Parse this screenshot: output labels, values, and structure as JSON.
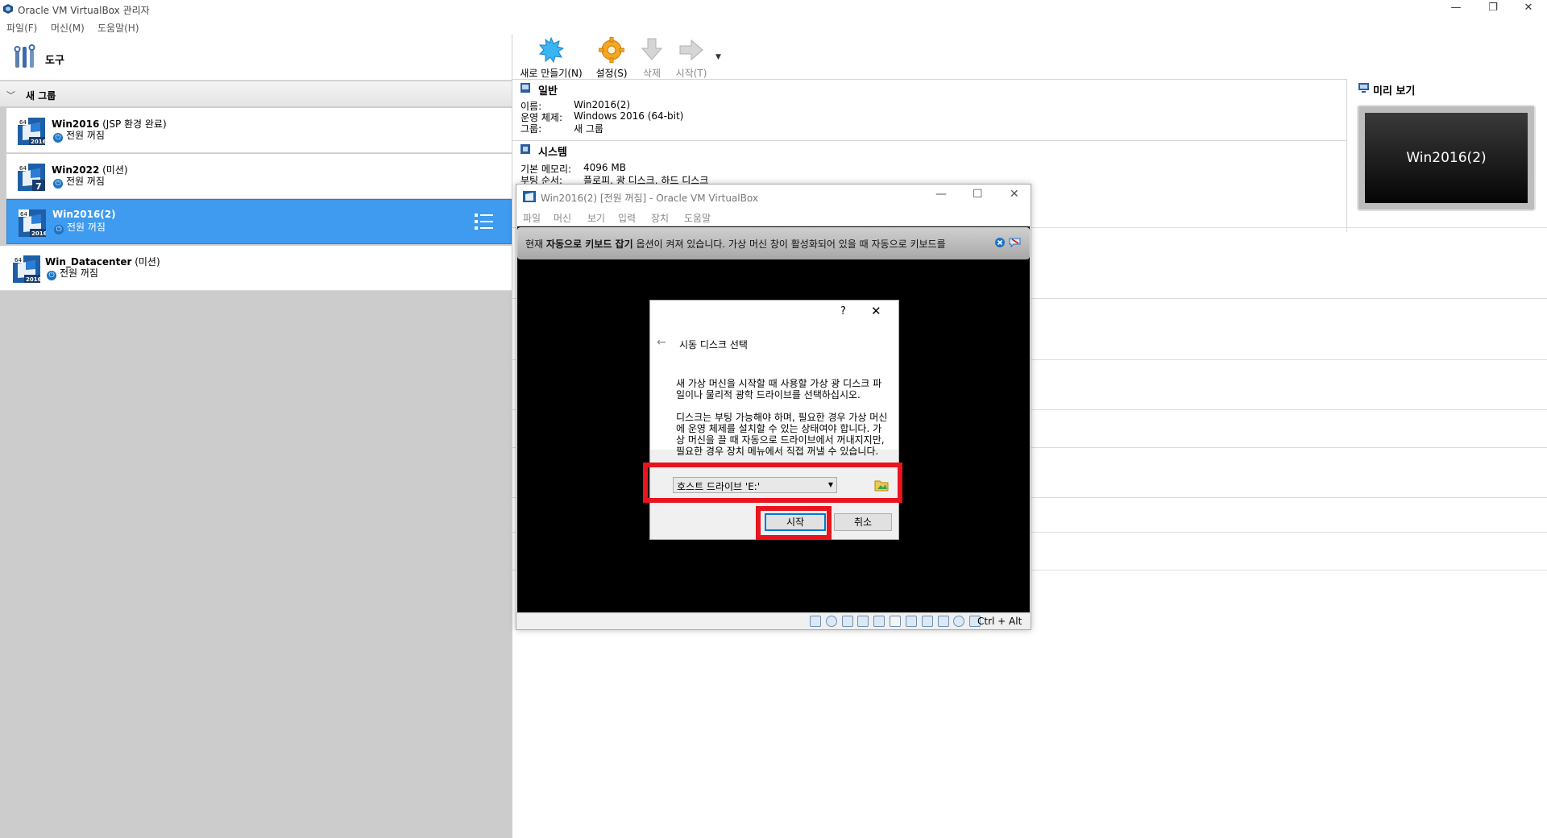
{
  "window": {
    "title": "Oracle VM VirtualBox 관리자"
  },
  "menu": [
    "파일(F)",
    "머신(M)",
    "도움말(H)"
  ],
  "tools": {
    "label": "도구"
  },
  "group": {
    "label": "새 그룹"
  },
  "vms": [
    {
      "name": "Win2016",
      "suffix": " (JSP 환경 완료)",
      "state": "전원 꺼짐",
      "badge_top": "64",
      "badge_bottom": "2016"
    },
    {
      "name": "Win2022",
      "suffix": " (미션)",
      "state": "전원 꺼짐",
      "badge_top": "64",
      "badge_bottom": "7"
    },
    {
      "name": "Win2016(2)",
      "suffix": "",
      "state": "전원 꺼짐",
      "badge_top": "64",
      "badge_bottom": "2016",
      "selected": true
    },
    {
      "name": "Win_Datacenter",
      "suffix": " (미션)",
      "state": "전원 꺼짐",
      "badge_top": "64",
      "badge_bottom": "2016"
    }
  ],
  "toolbar": {
    "new": "새로 만들기(N)",
    "settings": "설정(S)",
    "delete": "삭제",
    "start": "시작(T)"
  },
  "details": {
    "general": {
      "title": "일반",
      "name_label": "이름:",
      "name_value": "Win2016(2)",
      "os_label": "운영 체제:",
      "os_value": "Windows 2016 (64-bit)",
      "group_label": "그룹:",
      "group_value": "새 그룹"
    },
    "system": {
      "title": "시스템",
      "memory_label": "기본 메모리:",
      "memory_value": "4096 MB",
      "boot_label": "부팅 순서:",
      "boot_value": "플로피, 광 디스크, 하드 디스크"
    }
  },
  "preview": {
    "title": "미리 보기",
    "screen_text": "Win2016(2)"
  },
  "vm_window": {
    "title": "Win2016(2) [전원 꺼짐] - Oracle VM VirtualBox",
    "menu": [
      "파일",
      "머신",
      "보기",
      "입력",
      "장치",
      "도움말"
    ],
    "notice_pre": "현재 ",
    "notice_bold": "자동으로 키보드 잡기",
    "notice_post": " 옵션이 켜져 있습니다. 가상 머신 창이 활성화되어 있을 때 자동으로 키보드를",
    "host_key": "Ctrl + Alt"
  },
  "dialog": {
    "help": "?",
    "title": "시동 디스크 선택",
    "para1": "새 가상 머신을 시작할 때 사용할 가상 광 디스크 파일이나 물리적 광학 드라이브를 선택하십시오.",
    "para2": "디스크는 부팅 가능해야 하며, 필요한 경우 가상 머신에 운영 체제를 설치할 수 있는 상태여야 합니다. 가상 머신을 끌 때 자동으로 드라이브에서 꺼내지지만, 필요한 경우 장치 메뉴에서 직접 꺼낼 수 있습니다.",
    "selected_disk": "호스트 드라이브 'E:'",
    "start": "시작",
    "cancel": "취소"
  },
  "colors": {
    "selection": "#3e9bf0",
    "highlight": "#e8141e",
    "focus": "#0078d7"
  }
}
